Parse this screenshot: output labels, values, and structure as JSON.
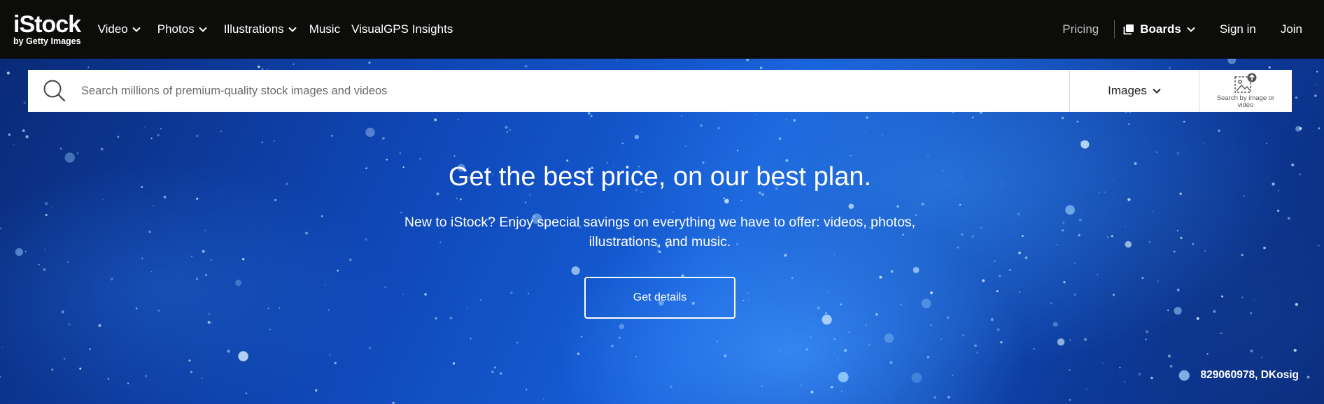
{
  "brand": {
    "logo_main": "iStock",
    "logo_sub": "by Getty Images"
  },
  "nav": {
    "items": [
      {
        "label": "Video",
        "has_dropdown": true
      },
      {
        "label": "Photos",
        "has_dropdown": true
      },
      {
        "label": "Illustrations",
        "has_dropdown": true
      },
      {
        "label": "Music",
        "has_dropdown": false
      },
      {
        "label": "VisualGPS Insights",
        "has_dropdown": false
      }
    ],
    "pricing": "Pricing",
    "boards": "Boards",
    "sign_in": "Sign in",
    "join": "Join"
  },
  "search": {
    "placeholder": "Search millions of premium-quality stock images and videos",
    "value": "",
    "type_selected": "Images",
    "image_search_label": "Search by image or video"
  },
  "hero": {
    "headline": "Get the best price, on our best plan.",
    "subtext": "New to iStock? Enjoy special savings on everything we have to offer: videos, photos, illustrations, and music.",
    "cta_label": "Get details",
    "credit": "829060978, DKosig"
  },
  "colors": {
    "topbar_bg": "#0c0d0b",
    "hero_blue": "#165fd9",
    "text_white": "#ffffff",
    "pricing_gray": "#bfbfbf"
  },
  "icons": {
    "search": "search-icon",
    "chevron": "chevron-down-icon",
    "boards": "boards-icon",
    "image_search": "image-upload-icon"
  }
}
